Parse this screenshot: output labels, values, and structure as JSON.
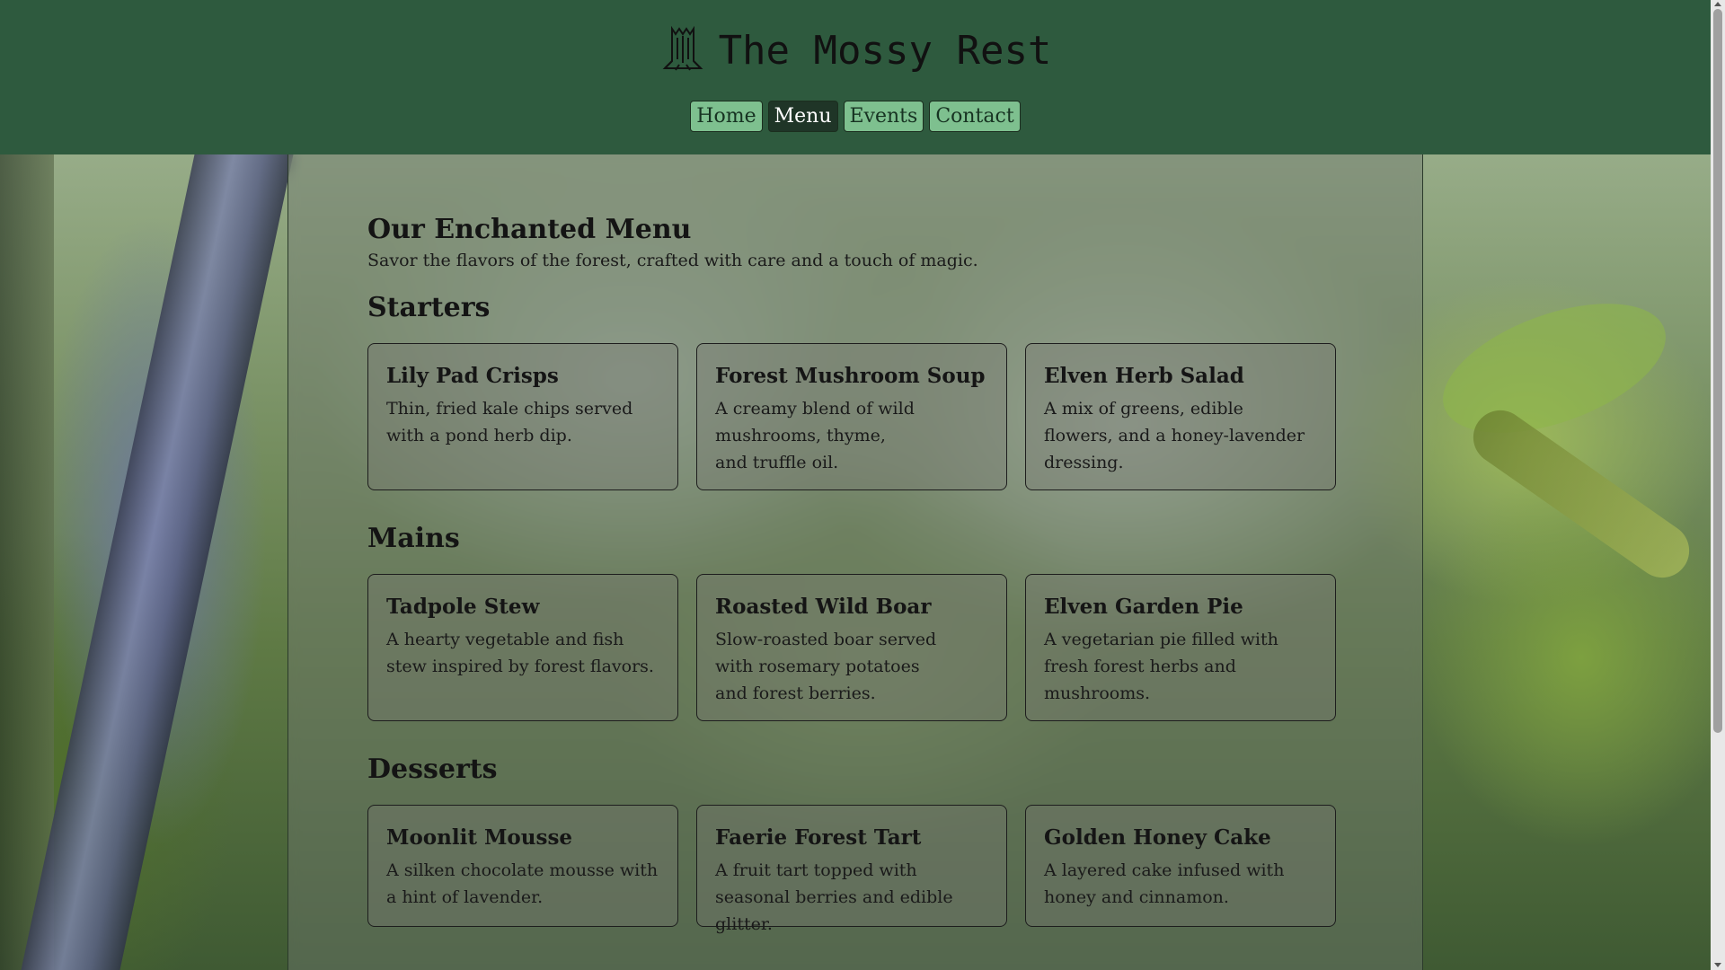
{
  "header": {
    "title": "The Mossy Rest",
    "logo_icon": "tree-stump-icon",
    "nav": [
      {
        "label": "Home",
        "active": false
      },
      {
        "label": "Menu",
        "active": true
      },
      {
        "label": "Events",
        "active": false
      },
      {
        "label": "Contact",
        "active": false
      }
    ]
  },
  "main": {
    "title": "Our Enchanted Menu",
    "subtitle": "Savor the flavors of the forest, crafted with care and a touch of magic.",
    "sections": [
      {
        "title": "Starters",
        "items": [
          {
            "name": "Lily Pad Crisps",
            "desc": "Thin, fried kale chips served with a pond herb dip."
          },
          {
            "name": "Forest Mushroom Soup",
            "desc": "A creamy blend of wild mushrooms, thyme, and truffle oil."
          },
          {
            "name": "Elven Herb Salad",
            "desc": "A mix of greens, edible flowers, and a honey-lavender dressing."
          }
        ]
      },
      {
        "title": "Mains",
        "items": [
          {
            "name": "Tadpole Stew",
            "desc": "A hearty vegetable and fish stew inspired by forest flavors."
          },
          {
            "name": "Roasted Wild Boar",
            "desc": "Slow-roasted boar served with rosemary potatoes and forest berries."
          },
          {
            "name": "Elven Garden Pie",
            "desc": "A vegetarian pie filled with fresh forest herbs and mushrooms."
          }
        ]
      },
      {
        "title": "Desserts",
        "items": [
          {
            "name": "Moonlit Mousse",
            "desc": "A silken chocolate mousse with a hint of lavender."
          },
          {
            "name": "Faerie Forest Tart",
            "desc": "A fruit tart topped with seasonal berries and edible glitter."
          },
          {
            "name": "Golden Honey Cake",
            "desc": "A layered cake infused with honey and cinnamon."
          }
        ]
      }
    ]
  },
  "colors": {
    "header_bg": "#2e5a3e",
    "nav_bg": "#7ec08f",
    "nav_active_bg": "#1f3527"
  }
}
